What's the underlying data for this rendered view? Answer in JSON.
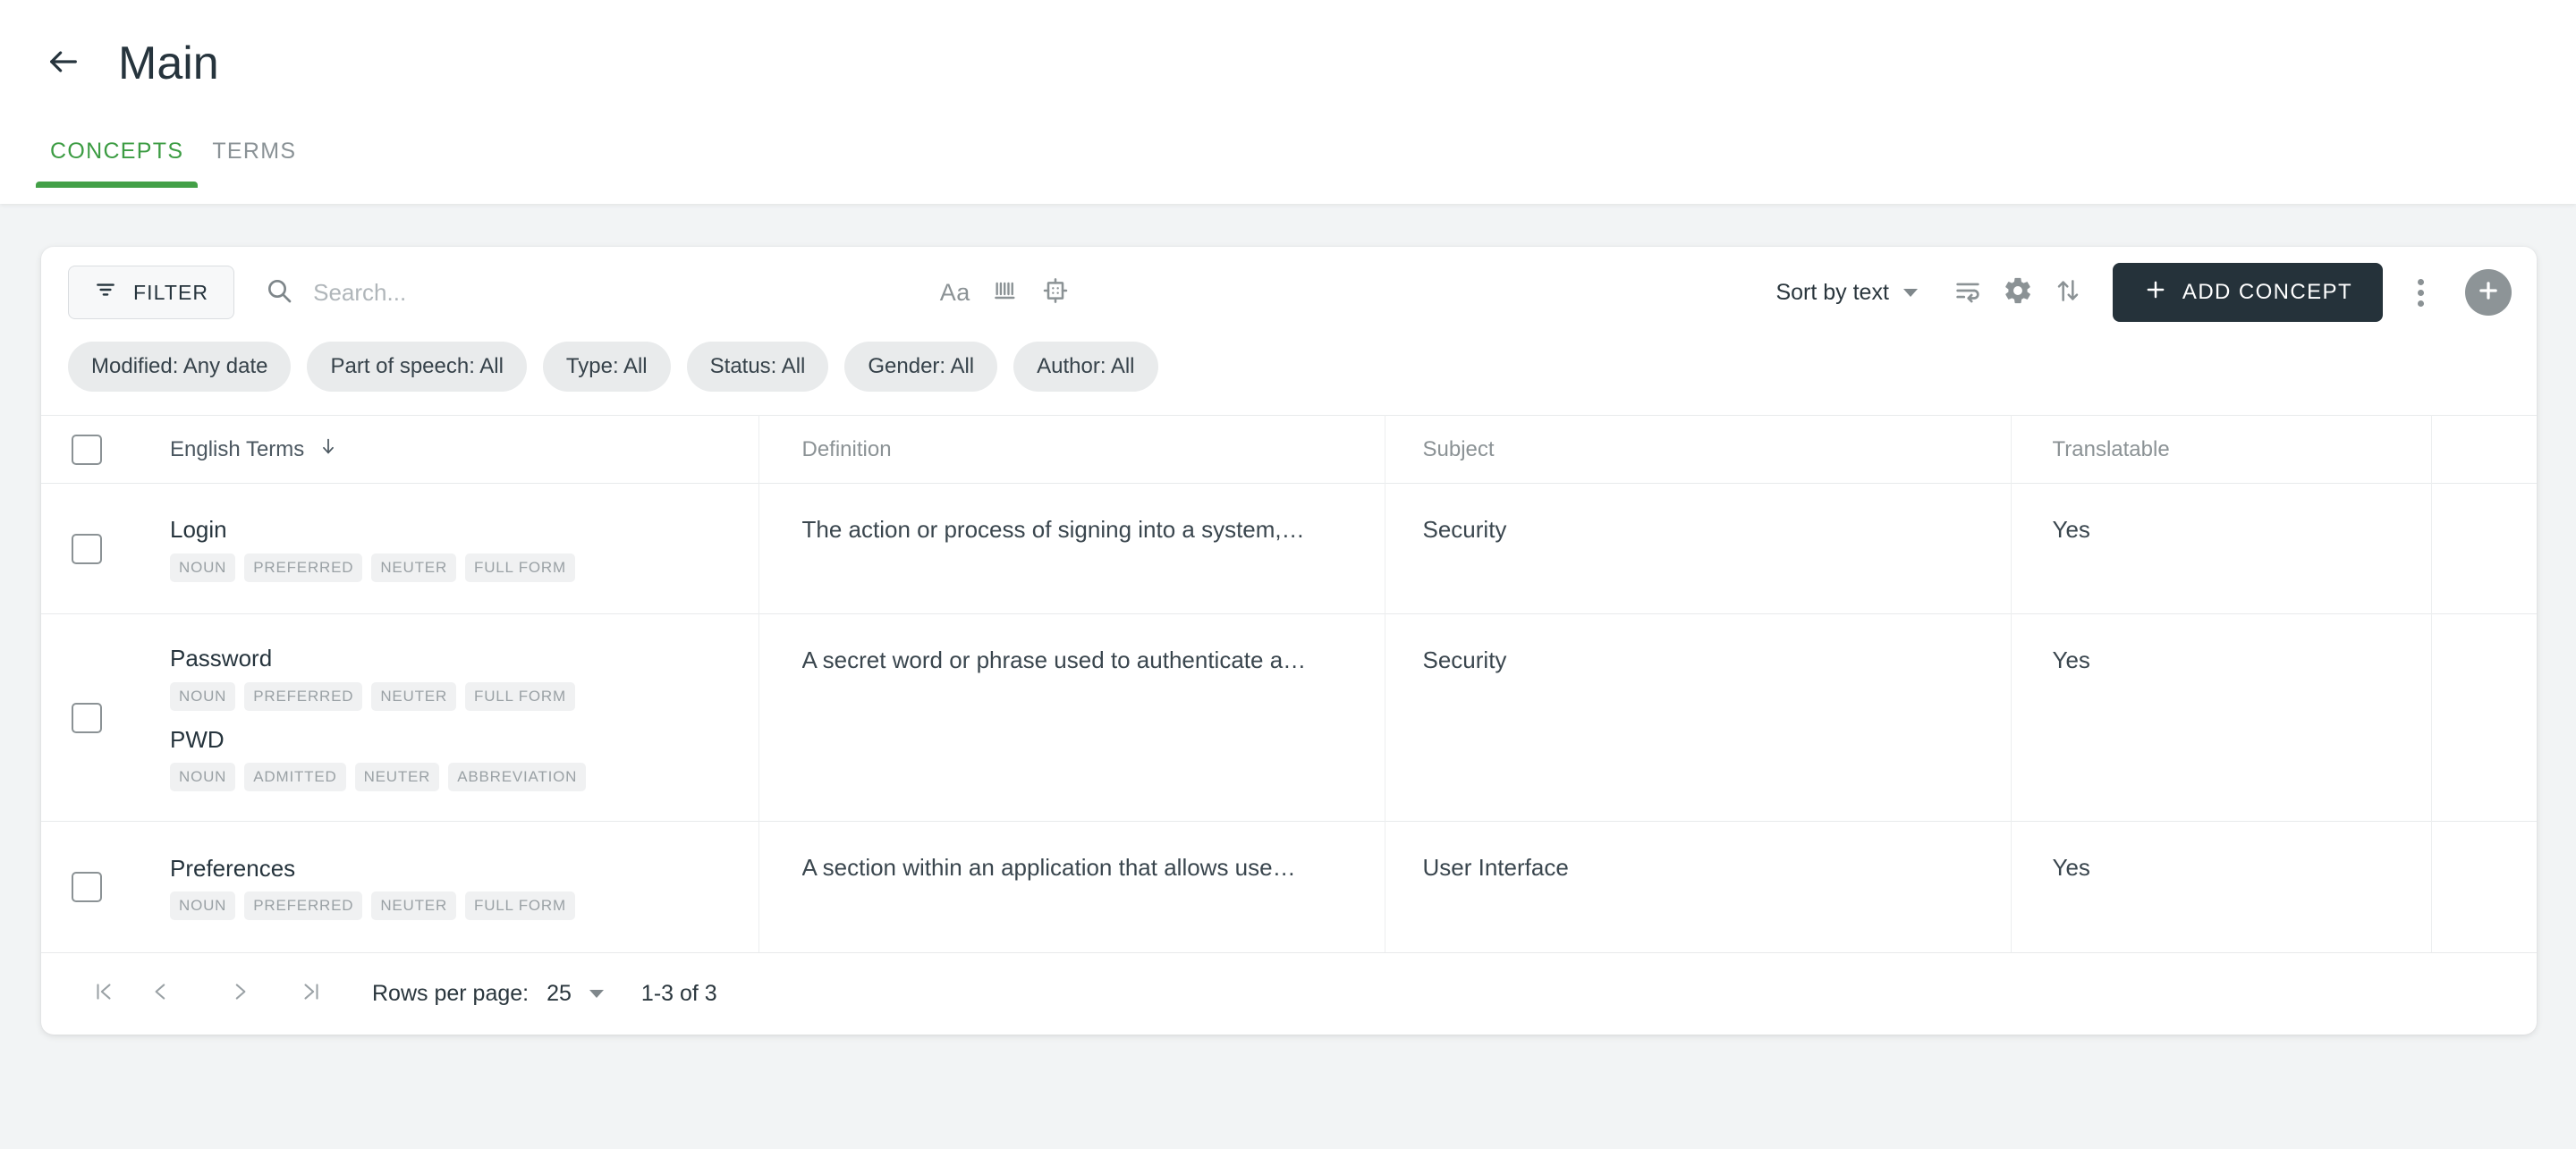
{
  "header": {
    "back_icon": "arrow-left-icon",
    "title": "Main",
    "tabs": [
      {
        "label": "CONCEPTS",
        "active": true
      },
      {
        "label": "TERMS",
        "active": false
      }
    ]
  },
  "toolbar": {
    "filter_label": "FILTER",
    "filter_icon": "filter-icon",
    "search_icon": "search-icon",
    "search_value": "",
    "search_placeholder": "Search...",
    "match_case_icon": "match-case-icon",
    "match_case_label": "Aa",
    "whole_word_icon": "whole-word-icon",
    "regex_icon": "regex-icon",
    "sort_label": "Sort by text",
    "wrap_text_icon": "wrap-text-icon",
    "settings_icon": "gear-icon",
    "sort_order_icon": "sort-arrows-icon",
    "add_concept_label": "ADD CONCEPT",
    "add_concept_icon": "plus-icon",
    "more_icon": "kebab-menu-icon",
    "fab_icon": "add-circle-icon"
  },
  "filter_chips": [
    {
      "label": "Modified: Any date"
    },
    {
      "label": "Part of speech: All"
    },
    {
      "label": "Type: All"
    },
    {
      "label": "Status: All"
    },
    {
      "label": "Gender: All"
    },
    {
      "label": "Author: All"
    }
  ],
  "table": {
    "columns": [
      {
        "key": "select",
        "label": ""
      },
      {
        "key": "terms",
        "label": "English Terms",
        "sort_icon": "arrow-down-icon"
      },
      {
        "key": "definition",
        "label": "Definition"
      },
      {
        "key": "subject",
        "label": "Subject"
      },
      {
        "key": "translatable",
        "label": "Translatable"
      },
      {
        "key": "extra",
        "label": ""
      }
    ],
    "rows": [
      {
        "terms": [
          {
            "name": "Login",
            "tags": [
              "NOUN",
              "PREFERRED",
              "NEUTER",
              "FULL FORM"
            ]
          }
        ],
        "definition": "The action or process of signing into a system,…",
        "subject": "Security",
        "translatable": "Yes"
      },
      {
        "terms": [
          {
            "name": "Password",
            "tags": [
              "NOUN",
              "PREFERRED",
              "NEUTER",
              "FULL FORM"
            ]
          },
          {
            "name": "PWD",
            "tags": [
              "NOUN",
              "ADMITTED",
              "NEUTER",
              "ABBREVIATION"
            ]
          }
        ],
        "definition": "A secret word or phrase used to authenticate a…",
        "subject": "Security",
        "translatable": "Yes"
      },
      {
        "terms": [
          {
            "name": "Preferences",
            "tags": [
              "NOUN",
              "PREFERRED",
              "NEUTER",
              "FULL FORM"
            ]
          }
        ],
        "definition": "A section within an application that allows use…",
        "subject": "User Interface",
        "translatable": "Yes"
      }
    ]
  },
  "footer": {
    "first_page_icon": "first-page-icon",
    "prev_page_icon": "chevron-left-icon",
    "next_page_icon": "chevron-right-icon",
    "last_page_icon": "last-page-icon",
    "rows_per_page_label": "Rows per page:",
    "rows_per_page_value": "25",
    "range_label": "1-3 of 3"
  },
  "colors": {
    "accent_green": "#43a047",
    "dark_button": "#25323a",
    "page_bg": "#f2f4f5",
    "muted_text": "#8b9295"
  }
}
